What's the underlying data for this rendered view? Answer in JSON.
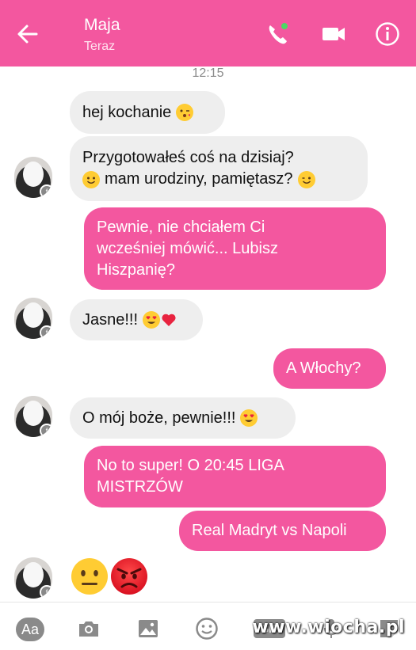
{
  "header": {
    "contact_name": "Maja",
    "status": "Teraz",
    "accent_color": "#f3579f",
    "icons": [
      "back-arrow-icon",
      "phone-call-icon",
      "video-call-icon",
      "info-icon"
    ]
  },
  "conversation": {
    "timestamp": "12:15",
    "messages": [
      {
        "from": "contact",
        "text": "hej kochanie",
        "emoji": "kissing-wink-emoji"
      },
      {
        "from": "contact",
        "line1": "Przygotowałeś coś na dzisiaj?",
        "line2": "mam urodziny, pamiętasz?",
        "emoji": "smile-emoji"
      },
      {
        "from": "me",
        "line1": "Pewnie, nie chciałem Ci",
        "line2": "wcześniej mówić... Lubisz",
        "line3": "Hiszpanię?"
      },
      {
        "from": "contact",
        "text": "Jasne!!!",
        "emoji": "heart-eyes-emoji"
      },
      {
        "from": "me",
        "text": "A Włochy?"
      },
      {
        "from": "contact",
        "text": "O mój boże, pewnie!!!",
        "emoji": "heart-eyes-emoji"
      },
      {
        "from": "me",
        "line1": "No to super! O 20:45 LIGA",
        "line2": "MISTRZÓW"
      },
      {
        "from": "me",
        "text": "Real Madryt vs Napoli"
      },
      {
        "from": "contact",
        "emojis": [
          "neutral-face-emoji",
          "angry-face-emoji"
        ]
      }
    ]
  },
  "composer": {
    "aa_label": "Aa",
    "gif_label": "GIF",
    "icons": [
      "text-format-icon",
      "camera-icon",
      "image-icon",
      "emoji-icon",
      "gif-icon",
      "microphone-icon",
      "sticker-icon"
    ]
  },
  "watermark": "www.wiocha.pl"
}
